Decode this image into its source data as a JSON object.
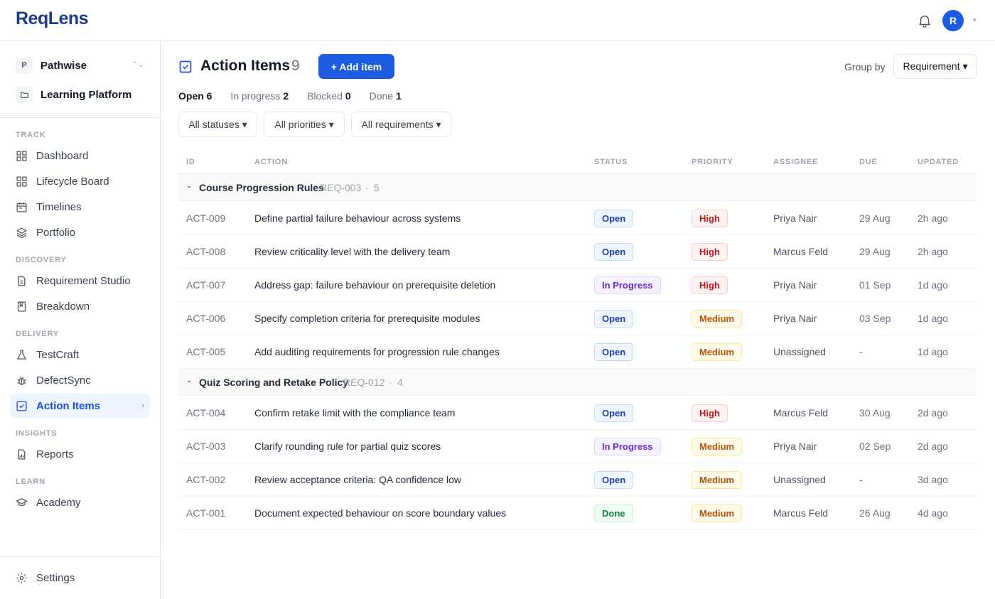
{
  "app": {
    "logo": "ReqLens",
    "user_initial": "R",
    "caret": "▾"
  },
  "workspace": {
    "badge": "P",
    "name": "Pathwise",
    "project": "Learning Platform",
    "switch": "⌃⌄"
  },
  "sidebar": {
    "sections": [
      {
        "label": "TRACK",
        "items": [
          {
            "label": "Dashboard",
            "icon": "grid-icon"
          },
          {
            "label": "Lifecycle Board",
            "icon": "board-icon"
          },
          {
            "label": "Timelines",
            "icon": "calendar-icon"
          },
          {
            "label": "Portfolio",
            "icon": "layers-icon"
          }
        ]
      },
      {
        "label": "DISCOVERY",
        "items": [
          {
            "label": "Requirement Studio",
            "icon": "document-icon"
          },
          {
            "label": "Breakdown",
            "icon": "bookmark-icon"
          }
        ]
      },
      {
        "label": "DELIVERY",
        "items": [
          {
            "label": "TestCraft",
            "icon": "flask-icon"
          },
          {
            "label": "DefectSync",
            "icon": "bug-icon"
          },
          {
            "label": "Action Items",
            "icon": "checkbox-icon",
            "active": true,
            "chevron": "›"
          }
        ]
      },
      {
        "label": "INSIGHTS",
        "items": [
          {
            "label": "Reports",
            "icon": "report-icon"
          }
        ]
      },
      {
        "label": "LEARN",
        "items": [
          {
            "label": "Academy",
            "icon": "graduation-cap-icon"
          }
        ]
      }
    ],
    "settings": "Settings"
  },
  "page": {
    "title": "Action Items",
    "count": "9",
    "add_button": "+ Add item",
    "group_by_label": "Group by",
    "group_by_value": "Requirement ▾"
  },
  "summary": {
    "open_label": "Open",
    "open": "6",
    "progress_label": "In progress",
    "progress": "2",
    "blocked_label": "Blocked",
    "blocked": "0",
    "done_label": "Done",
    "done": "1"
  },
  "filters": {
    "status": "All statuses ▾",
    "priority": "All priorities ▾",
    "requirement": "All requirements ▾"
  },
  "table": {
    "headers": {
      "id": "ID",
      "action": "ACTION",
      "status": "STATUS",
      "priority": "PRIORITY",
      "assignee": "ASSIGNEE",
      "due": "DUE",
      "updated": "UPDATED"
    },
    "groups": [
      {
        "chevron": "⌄",
        "name": "Course Progression Rules",
        "req": "REQ-003",
        "sep": "·",
        "count": "5",
        "rows": [
          {
            "id": "ACT-009",
            "action": "Define partial failure behaviour across systems",
            "status": "Open",
            "priority": "High",
            "assignee": "Priya Nair",
            "due": "29 Aug",
            "updated": "2h ago"
          },
          {
            "id": "ACT-008",
            "action": "Review criticality level with the delivery team",
            "status": "Open",
            "priority": "High",
            "assignee": "Marcus Feld",
            "due": "29 Aug",
            "updated": "2h ago"
          },
          {
            "id": "ACT-007",
            "action": "Address gap: failure behaviour on prerequisite deletion",
            "status": "In Progress",
            "priority": "High",
            "assignee": "Priya Nair",
            "due": "01 Sep",
            "updated": "1d ago"
          },
          {
            "id": "ACT-006",
            "action": "Specify completion criteria for prerequisite modules",
            "status": "Open",
            "priority": "Medium",
            "assignee": "Priya Nair",
            "due": "03 Sep",
            "updated": "1d ago"
          },
          {
            "id": "ACT-005",
            "action": "Add auditing requirements for progression rule changes",
            "status": "Open",
            "priority": "Medium",
            "assignee": "Unassigned",
            "due": "-",
            "updated": "1d ago"
          }
        ]
      },
      {
        "chevron": "⌄",
        "name": "Quiz Scoring and Retake Policy",
        "req": "REQ-012",
        "sep": "·",
        "count": "4",
        "rows": [
          {
            "id": "ACT-004",
            "action": "Confirm retake limit with the compliance team",
            "status": "Open",
            "priority": "High",
            "assignee": "Marcus Feld",
            "due": "30 Aug",
            "updated": "2d ago"
          },
          {
            "id": "ACT-003",
            "action": "Clarify rounding rule for partial quiz scores",
            "status": "In Progress",
            "priority": "Medium",
            "assignee": "Priya Nair",
            "due": "02 Sep",
            "updated": "2d ago"
          },
          {
            "id": "ACT-002",
            "action": "Review acceptance criteria: QA confidence low",
            "status": "Open",
            "priority": "Medium",
            "assignee": "Unassigned",
            "due": "-",
            "updated": "3d ago"
          },
          {
            "id": "ACT-001",
            "action": "Document expected behaviour on score boundary values",
            "status": "Done",
            "priority": "Medium",
            "assignee": "Marcus Feld",
            "due": "26 Aug",
            "updated": "4d ago"
          }
        ]
      }
    ]
  },
  "colors": {
    "accent": "#1d5be0",
    "brand": "#1e3a8a",
    "active_bg": "#eef4ff"
  }
}
